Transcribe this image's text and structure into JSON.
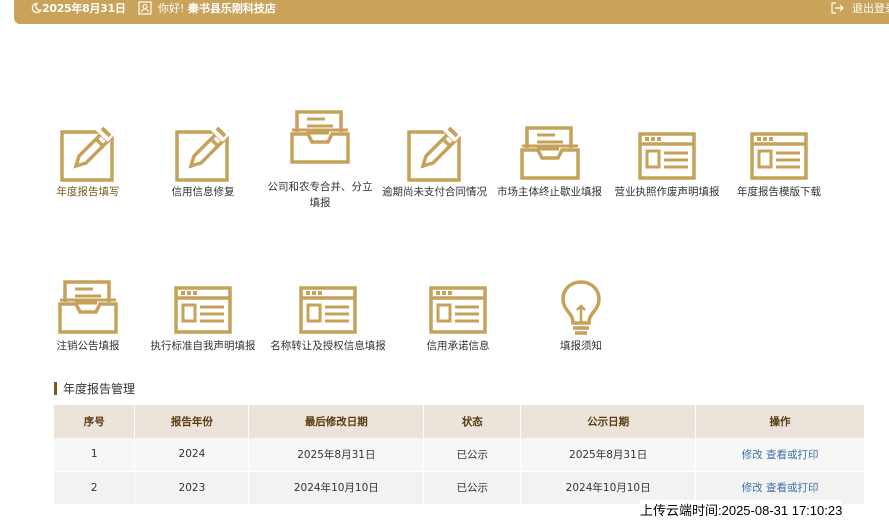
{
  "header": {
    "date": "2025年8月31日",
    "greeting": "你好!",
    "user_name": "秦书县乐刚科技店",
    "logout_label": "退出登录"
  },
  "icons_row1": [
    {
      "label": "年度报告填写",
      "icon": "edit-icon"
    },
    {
      "label": "信用信息修复",
      "icon": "edit-icon"
    },
    {
      "label": "公司和农专合并、分立",
      "label2": "填报",
      "icon": "inbox-icon"
    },
    {
      "label": "逾期尚未支付合同情况",
      "icon": "edit-icon"
    },
    {
      "label": "市场主体终止歇业填报",
      "icon": "inbox-icon"
    },
    {
      "label": "营业执照作废声明填报",
      "icon": "form-window-icon"
    },
    {
      "label": "年度报告模版下载",
      "icon": "form-window-icon"
    }
  ],
  "icons_row2": [
    {
      "label": "注销公告填报",
      "icon": "inbox-icon"
    },
    {
      "label": "执行标准自我声明填报",
      "icon": "form-window-icon"
    },
    {
      "label": "名称转让及授权信息填报",
      "icon": "form-window-icon"
    },
    {
      "label": "信用承诺信息",
      "icon": "form-window-icon"
    },
    {
      "label": "填报须知",
      "icon": "lightbulb-icon"
    }
  ],
  "section_title": "年度报告管理",
  "table": {
    "headers": [
      "序号",
      "报告年份",
      "最后修改日期",
      "状态",
      "公示日期",
      "操作"
    ],
    "rows": [
      {
        "no": "1",
        "year": "2024",
        "modified": "2025年8月31日",
        "status": "已公示",
        "published": "2025年8月31日",
        "edit": "修改",
        "view": "查看或打印"
      },
      {
        "no": "2",
        "year": "2023",
        "modified": "2024年10月10日",
        "status": "已公示",
        "published": "2024年10月10日",
        "edit": "修改",
        "view": "查看或打印"
      }
    ]
  },
  "upload_time": "上传云端时间:2025-08-31 17:10:23",
  "colors": {
    "accent": "#c9a35a",
    "icon_gold": "#c5a15a",
    "link": "#3c6fa8"
  }
}
